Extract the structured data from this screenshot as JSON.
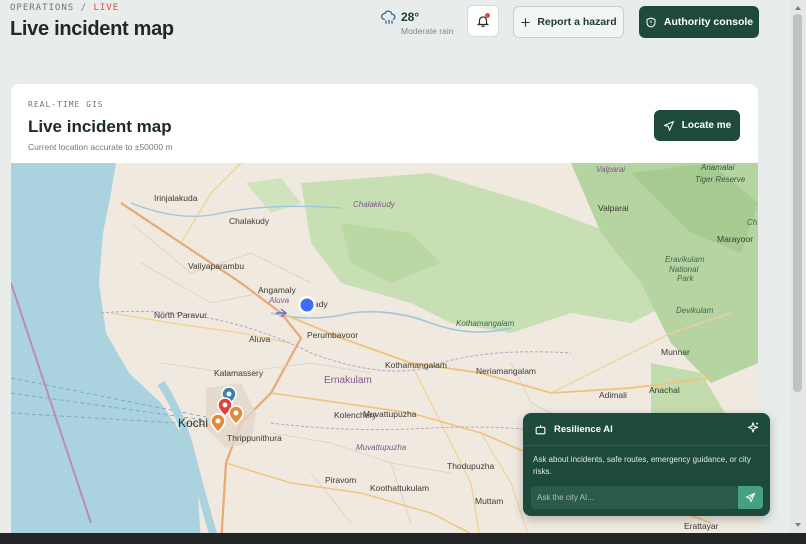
{
  "breadcrumb": {
    "section": "OPERATIONS",
    "separator": "/",
    "current": "LIVE"
  },
  "header": {
    "title": "Live incident map"
  },
  "weather": {
    "icon": "rain-cloud-icon",
    "temperature": "28°",
    "condition": "Moderate rain"
  },
  "notifications": {
    "icon": "bell-icon",
    "has_unread": true
  },
  "buttons": {
    "report_hazard": {
      "icon": "plus-icon",
      "label": "Report a hazard"
    },
    "authority_console": {
      "icon": "shield-icon",
      "label": "Authority console"
    },
    "locate_me": {
      "icon": "navigation-arrow-icon",
      "label": "Locate me"
    }
  },
  "card": {
    "kicker": "REAL-TIME GIS",
    "title": "Live incident map",
    "accuracy": "Current location accurate to ±50000 m"
  },
  "map": {
    "places": {
      "irinjalakuda": "Irinjalakuda",
      "chalakudy": "Chalakudy",
      "chalakkudy_river": "Chalakkudy",
      "valparai_river": "Valparai",
      "valparai": "Valparai",
      "anamalai": "Anamalai",
      "tiger_reserve": "Tiger Reserve",
      "ch": "Ch",
      "marayoor": "Marayoor",
      "valiyaparambu": "Valiyaparambu",
      "angamaly": "Angamaly",
      "aluva_river": "Aluva",
      "kalady": "lady",
      "eravikulam": "Eravikulam",
      "national": "National",
      "park": "Park",
      "devikulam": "Devikulam",
      "north_paravur": "North Paravur",
      "perumbavoor": "Perumbavoor",
      "kothamangalam_green": "Kothamangalam",
      "aluva": "Aluva",
      "munnar": "Munnar",
      "kothamangalam": "Kothamangalam",
      "neriamangalam": "Neriamangalam",
      "kalamassery": "Kalamassery",
      "ernakulam": "Ernakulam",
      "adimali": "Adimali",
      "anachal": "Anachal",
      "kochi": "Kochi",
      "kolenchery": "Kolenchery",
      "muvattupuzha": "Muvattupuzha",
      "thrippunithura": "Thrippunithura",
      "muvattupuzha_river": "Muvattupuzha",
      "thodupuzha": "Thodupuzha",
      "piravom": "Piravom",
      "koothattukulam": "Koothattukulam",
      "muttam": "Muttam",
      "erattayar": "Erattayar"
    },
    "user_location_color": "#3b6ef5",
    "incident_colors": [
      "#3a7fb0",
      "#d9433a",
      "#e08a3c",
      "#e08a3c"
    ]
  },
  "assistant": {
    "icon": "robot-icon",
    "title": "Resilience AI",
    "sparkle_icon": "sparkle-icon",
    "description": "Ask about incidents, safe routes, emergency guidance, or city risks.",
    "placeholder": "Ask the city AI...",
    "send_icon": "send-icon"
  },
  "colors": {
    "brand": "#1d4a3d",
    "accent": "#46a084",
    "alert": "#d2533f"
  }
}
